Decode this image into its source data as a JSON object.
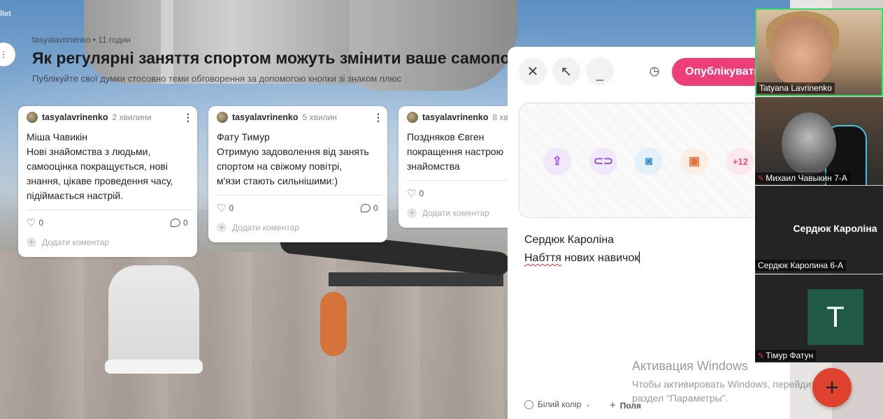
{
  "app": {
    "corner_label": "llet"
  },
  "board": {
    "author_meta": "tasyalavrinenko • 11 годин",
    "title": "Як регулярні заняття спортом можуть змінити ваше самопочуття?",
    "subtitle": "Публікуйте свої думки стосовно теми обговорення за допомогою кнопки зі знаком плюс"
  },
  "cards": [
    {
      "author": "tasyalavrinenko",
      "time": "2 хвилини",
      "lines": [
        "Міша Чавикін",
        "Нові знайомства з людьми,",
        "самооцінка покращується, нові",
        "знання, цікаве проведення часу,",
        "підіймається настрій."
      ],
      "likes": "0",
      "comments": "0",
      "add_comment": "Додати коментар"
    },
    {
      "author": "tasyalavrinenko",
      "time": "5 хвилин",
      "lines": [
        "Фату Тимур",
        "Отримую задоволення від занять",
        "спортом на свіжому повітрі, ",
        "м'язи стають сильнішими:)"
      ],
      "likes": "0",
      "comments": "0",
      "add_comment": "Додати коментар"
    },
    {
      "author": "tasyalavrinenko",
      "time": "8 хв",
      "lines": [
        "Поздняков Євген",
        "покращення настрою",
        "знайомства"
      ],
      "likes": "0",
      "add_comment": "Додати коментар"
    }
  ],
  "editor": {
    "publish_label": "Опублікувати",
    "attachment_more": "+12",
    "text_line1": "Сердюк Кароліна",
    "text_line2_word1": "Набття",
    "text_line2_rest": " нових навичок",
    "color_option": "Білий колір",
    "fields_option": "Поля"
  },
  "windows_activation": {
    "heading": "Активация Windows",
    "line1": "Чтобы активировать Windows, перейдите в",
    "line2": "раздел \"Параметры\"."
  },
  "video_call": {
    "tiles": [
      {
        "name": "Tatyana Lavrinenko",
        "muted": false
      },
      {
        "name": "Михаил Чавыкин 7-А",
        "muted": true
      },
      {
        "name": "Сердюк Каролина 6-А",
        "display_name": "Сердюк  Кароліна",
        "muted": false
      },
      {
        "name": "Тімур Фатун",
        "avatar_letter": "T",
        "muted": true
      }
    ]
  },
  "colors": {
    "publish": "#ee3e7a",
    "fab": "#e0402e",
    "active_speaker": "#3ad66b"
  },
  "icons": {
    "close": "close-icon",
    "expand": "expand-arrow-icon",
    "minimize": "minimize-icon",
    "schedule": "schedule-icon",
    "upload": "upload-file-icon",
    "link": "link-icon",
    "camera": "camera-icon",
    "image_search": "image-search-icon",
    "mic_off": "mic-off-icon",
    "add": "plus-icon"
  }
}
